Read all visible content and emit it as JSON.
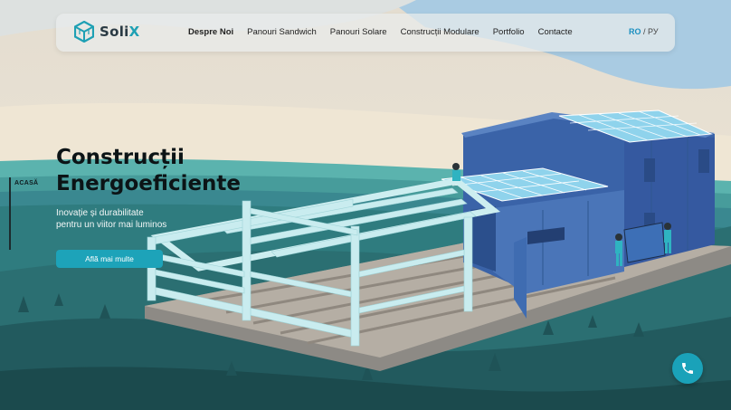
{
  "brand": {
    "name_main": "Soli",
    "name_accent": "X"
  },
  "nav": {
    "items": [
      {
        "label": "Despre Noi",
        "active": true
      },
      {
        "label": "Panouri Sandwich",
        "active": false
      },
      {
        "label": "Panouri Solare",
        "active": false
      },
      {
        "label": "Construcții Modulare",
        "active": false
      },
      {
        "label": "Portfolio",
        "active": false
      },
      {
        "label": "Contacte",
        "active": false
      }
    ],
    "lang_active": "RO",
    "lang_sep": " / ",
    "lang_other": "РУ"
  },
  "side": {
    "label": "ACASĂ"
  },
  "hero": {
    "title_line1": "Construcții",
    "title_line2": "Energoeficiente",
    "subtitle_line1": "Inovație și durabilitate",
    "subtitle_line2": "pentru un viitor mai luminos",
    "cta_label": "Află mai multe"
  },
  "colors": {
    "accent": "#1da3b9",
    "brand_text": "#2a3a44",
    "building": "#3a63a8"
  },
  "icons": {
    "logo": "cube-logo-icon",
    "phone": "phone-icon"
  }
}
